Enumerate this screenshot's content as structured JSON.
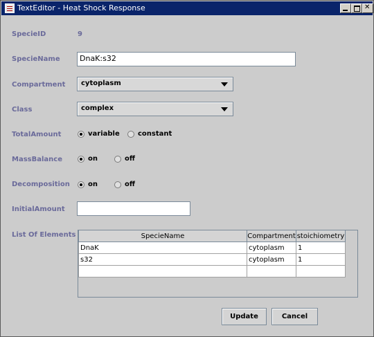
{
  "window": {
    "title": "TextEditor - Heat Shock Response"
  },
  "form": {
    "specie_id": {
      "label": "SpecieID",
      "value": "9"
    },
    "specie_name": {
      "label": "SpecieName",
      "value": "DnaK:s32"
    },
    "compartment": {
      "label": "Compartment",
      "selected": "cytoplasm"
    },
    "class": {
      "label": "Class",
      "selected": "complex"
    },
    "total_amount": {
      "label": "TotalAmount",
      "options": [
        "variable",
        "constant"
      ],
      "selected": "variable"
    },
    "mass_balance": {
      "label": "MassBalance",
      "options": [
        "on",
        "off"
      ],
      "selected": "on"
    },
    "decomposition": {
      "label": "Decomposition",
      "options": [
        "on",
        "off"
      ],
      "selected": "on"
    },
    "initial_amount": {
      "label": "InitialAmount",
      "value": ""
    },
    "elements": {
      "label": "List Of Elements",
      "columns": [
        "SpecieName",
        "Compartment",
        "stoichiometry"
      ],
      "rows": [
        [
          "DnaK",
          "cytoplasm",
          "1"
        ],
        [
          "s32",
          "cytoplasm",
          "1"
        ],
        [
          "",
          "",
          ""
        ]
      ]
    }
  },
  "buttons": {
    "update": "Update",
    "cancel": "Cancel"
  }
}
